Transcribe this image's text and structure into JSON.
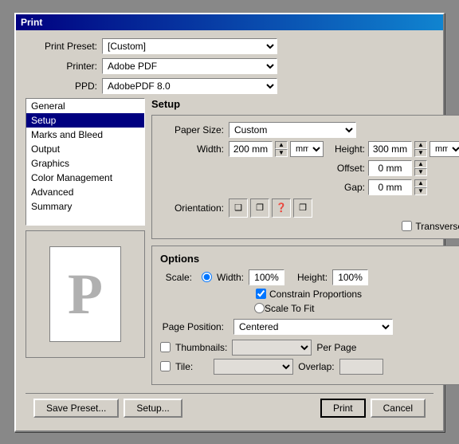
{
  "dialog": {
    "title": "Print",
    "preset_label": "Print Preset:",
    "printer_label": "Printer:",
    "ppd_label": "PPD:",
    "preset_value": "[Custom]",
    "printer_value": "Adobe PDF",
    "ppd_value": "AdobePDF 8.0"
  },
  "nav": {
    "items": [
      {
        "label": "General"
      },
      {
        "label": "Setup"
      },
      {
        "label": "Marks and Bleed"
      },
      {
        "label": "Output"
      },
      {
        "label": "Graphics"
      },
      {
        "label": "Color Management"
      },
      {
        "label": "Advanced"
      },
      {
        "label": "Summary"
      }
    ],
    "active": 1
  },
  "setup": {
    "section_title": "Setup",
    "paper_size_label": "Paper Size:",
    "paper_size_value": "Custom",
    "width_label": "Width:",
    "width_value": "200 mm",
    "height_label": "Height:",
    "height_value": "300 mm",
    "offset_label": "Offset:",
    "offset_value": "0 mm",
    "gap_label": "Gap:",
    "gap_value": "0 mm",
    "orientation_label": "Orientation:",
    "transverse_label": "Transverse"
  },
  "options": {
    "section_title": "Options",
    "scale_label": "Scale:",
    "width_radio": "Width:",
    "width_pct": "100%",
    "height_label": "Height:",
    "height_pct": "100%",
    "constrain_label": "Constrain Proportions",
    "scalefit_label": "Scale To Fit",
    "page_position_label": "Page Position:",
    "page_position_value": "Centered",
    "thumbnails_label": "Thumbnails:",
    "per_page_label": "Per Page",
    "tile_label": "Tile:",
    "overlap_label": "Overlap:"
  },
  "buttons": {
    "save_preset": "Save Preset...",
    "setup": "Setup...",
    "print": "Print",
    "cancel": "Cancel"
  }
}
